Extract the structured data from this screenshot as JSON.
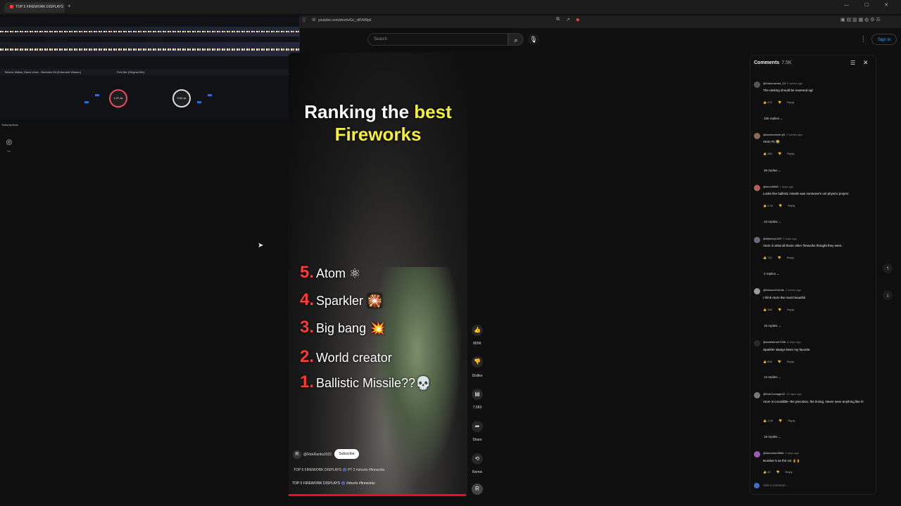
{
  "browser": {
    "tab_title": "TOP 5 FIREWORK DISPLAYS",
    "new_tab": "+",
    "url": "youtube.com/shorts/Gc_xBVkf9pk",
    "window_controls": "— ☐ ✕"
  },
  "dj_app": {
    "track_left": "Tchami, Malaa, Disco Lines - Nineteen 84 (Extended Version)",
    "track_right": "Find Me (Original Mix)",
    "jog_left": "1:27.4s",
    "jog_right": "0:02.4s"
  },
  "sidebar": {
    "subscriptions_label": "Subscriptions",
    "you_label": "You"
  },
  "header": {
    "search_placeholder": "Search",
    "sign_in": "Sign in"
  },
  "video": {
    "title_white": "Ranking the ",
    "title_yellow": "best",
    "title_line2": "Fireworks",
    "rankings": [
      {
        "n": "5.",
        "name": "Atom",
        "emoji": "⚛"
      },
      {
        "n": "4.",
        "name": "Sparkler",
        "emoji": "🎇"
      },
      {
        "n": "3.",
        "name": "Big bang",
        "emoji": "💥"
      },
      {
        "n": "2.",
        "name": "World creator",
        "emoji": ""
      },
      {
        "n": "1.",
        "name": "Ballistic Missile??",
        "emoji": "💀"
      }
    ],
    "channel": "@RickRanks2022",
    "subscribe": "Subscribe",
    "desc_line1": "TOP 5 FIREWORK DISPLAYS 🎆 PT 2 #shorts #fireworks",
    "desc_line2": "TOP 5 FIREWORK DISPLAYS 🎆 #shorts #fireworks",
    "progress": 1.0
  },
  "actions": {
    "like_count": "865K",
    "dislike_label": "Dislike",
    "comments_count": "7,583",
    "share_label": "Share",
    "remix_label": "Remix"
  },
  "comments": {
    "heading": "Comments",
    "count": "7.5K",
    "add_placeholder": "Add a comment...",
    "reply_label": "Reply",
    "items": [
      {
        "user": "@Unknowned_04",
        "time": "2 weeks ago",
        "text": "The ranking should be reversed ngl",
        "likes": "47K",
        "replies": "155 replies",
        "avatar": "#555555"
      },
      {
        "user": "@lovesummer-jf4",
        "time": "2 weeks ago",
        "text": "Atom #1 😂",
        "likes": "26K",
        "replies": "39 replies",
        "avatar": "#8a6a55"
      },
      {
        "user": "@anox6558",
        "time": "1 days ago",
        "text": "Looks like ballistic missile was someone's uni physics project",
        "likes": "4.1K",
        "replies": "10 replies",
        "avatar": "#b0605a"
      },
      {
        "user": "@dljimmy1029",
        "time": "5 days ago",
        "text": "Atom is what all those other fireworks thought they were.",
        "likes": "710",
        "replies": "2 replies",
        "avatar": "#6a6a7a"
      },
      {
        "user": "@NonsenGerrits",
        "time": "2 weeks ago",
        "text": "I think Atom the most beautiful",
        "likes": "16K",
        "replies": "15 replies",
        "avatar": "#999999"
      },
      {
        "user": "@asdiwbnoe7286",
        "time": "6 days ago",
        "text": "Sparkler always been my favorite.",
        "likes": "805",
        "replies": "14 replies",
        "avatar": "#2a2a2a"
      },
      {
        "user": "@DonComage42",
        "time": "10 days ago",
        "text": "Atom is incredible--the precision, the timing. Never seen anything like it!",
        "likes": "1.2K",
        "replies": "19 replies",
        "avatar": "#777777"
      },
      {
        "user": "@lammmm5806",
        "time": "6 days ago",
        "text": "Number 5 as the 1st 👌👌",
        "likes": "40",
        "replies": "",
        "avatar": "#9b59b6"
      }
    ]
  }
}
